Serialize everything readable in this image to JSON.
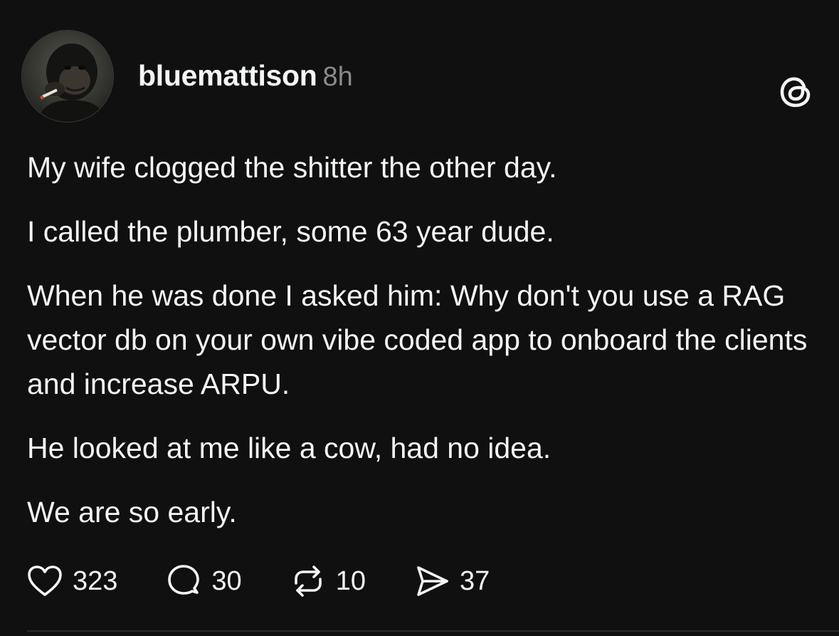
{
  "post": {
    "author": {
      "username": "bluemattison",
      "timestamp": "8h"
    },
    "paragraphs": [
      "My wife clogged the shitter the other day.",
      "I called the plumber, some 63 year dude.",
      "When he was done I asked him: Why don't you use a RAG vector db on your own vibe coded app to onboard the clients and increase ARPU.",
      "He looked at me like a cow, had no idea.",
      "We are so early."
    ],
    "stats": {
      "likes": "323",
      "replies": "30",
      "reposts": "10",
      "shares": "37"
    }
  },
  "icons": {
    "platform": "threads-logo-icon",
    "like": "heart-icon",
    "reply": "speech-bubble-icon",
    "repost": "repost-icon",
    "share": "send-icon"
  },
  "colors": {
    "background": "#101010",
    "text": "#f3f5f7",
    "muted": "#8a8a8a"
  }
}
